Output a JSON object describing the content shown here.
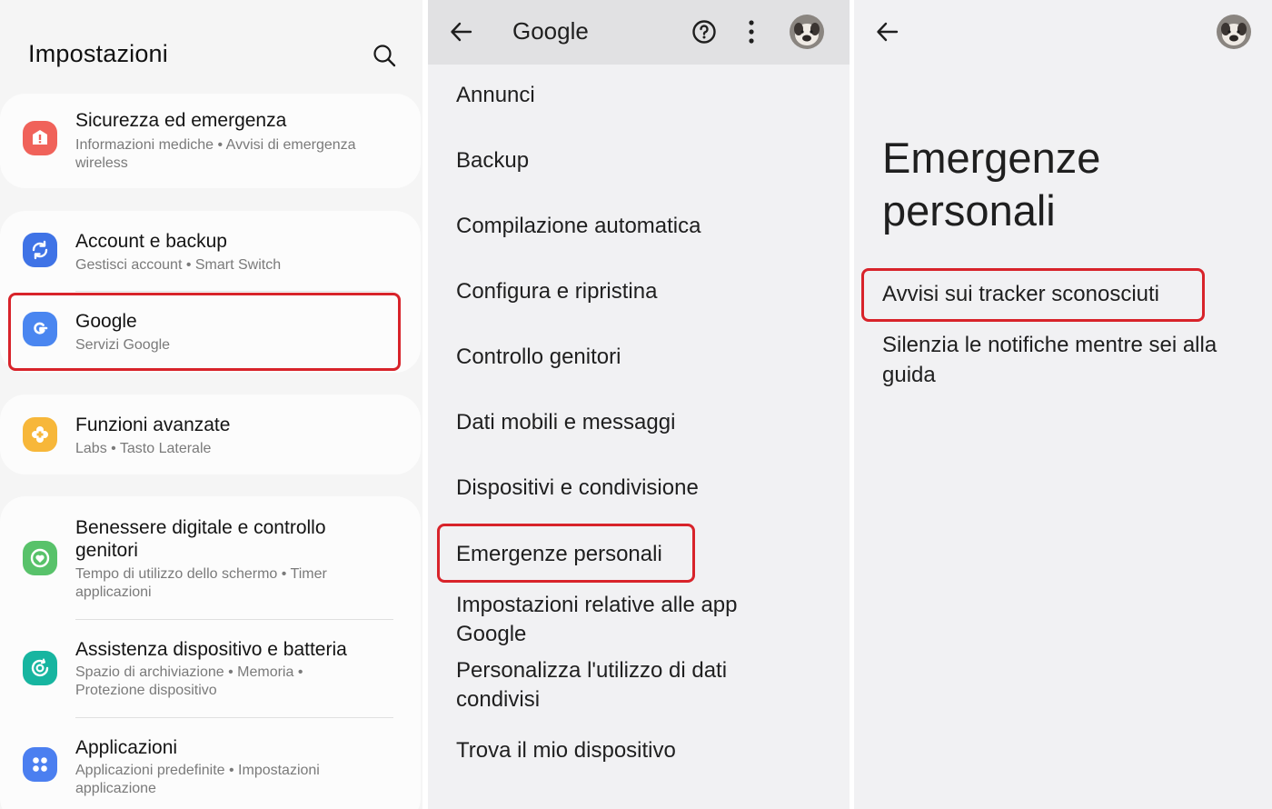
{
  "settings": {
    "title": "Impostazioni",
    "items": [
      {
        "title": "Sicurezza ed emergenza",
        "subtitle": "Informazioni mediche  •  Avvisi di emergenza wireless",
        "color": "#f0625a"
      },
      {
        "title": "Account e backup",
        "subtitle": "Gestisci account  •  Smart Switch",
        "color": "#3f73e6"
      },
      {
        "title": "Google",
        "subtitle": "Servizi Google",
        "color": "#4a86f0"
      },
      {
        "title": "Funzioni avanzate",
        "subtitle": "Labs  •  Tasto Laterale",
        "color": "#f7b73a"
      },
      {
        "title": "Benessere digitale e controllo genitori",
        "subtitle": "Tempo di utilizzo dello schermo  •  Timer applicazioni",
        "color": "#58c26a"
      },
      {
        "title": "Assistenza dispositivo e batteria",
        "subtitle": "Spazio di archiviazione  •  Memoria  •  Protezione dispositivo",
        "color": "#17b5a0"
      },
      {
        "title": "Applicazioni",
        "subtitle": "Applicazioni predefinite  •  Impostazioni applicazione",
        "color": "#4b7ff0"
      }
    ]
  },
  "google": {
    "title": "Google",
    "items": [
      "Annunci",
      "Backup",
      "Compilazione automatica",
      "Configura e ripristina",
      "Controllo genitori",
      "Dati mobili e messaggi",
      "Dispositivi e condivisione",
      "Emergenze personali",
      "Impostazioni relative alle app Google",
      "Personalizza l'utilizzo di dati condivisi",
      "Trova il mio dispositivo"
    ]
  },
  "emergency": {
    "title": "Emergenze personali",
    "items": [
      "Avvisi sui tracker sconosciuti",
      "Silenzia le notifiche mentre sei alla guida"
    ]
  },
  "colors": {
    "highlight": "#d8232a"
  }
}
